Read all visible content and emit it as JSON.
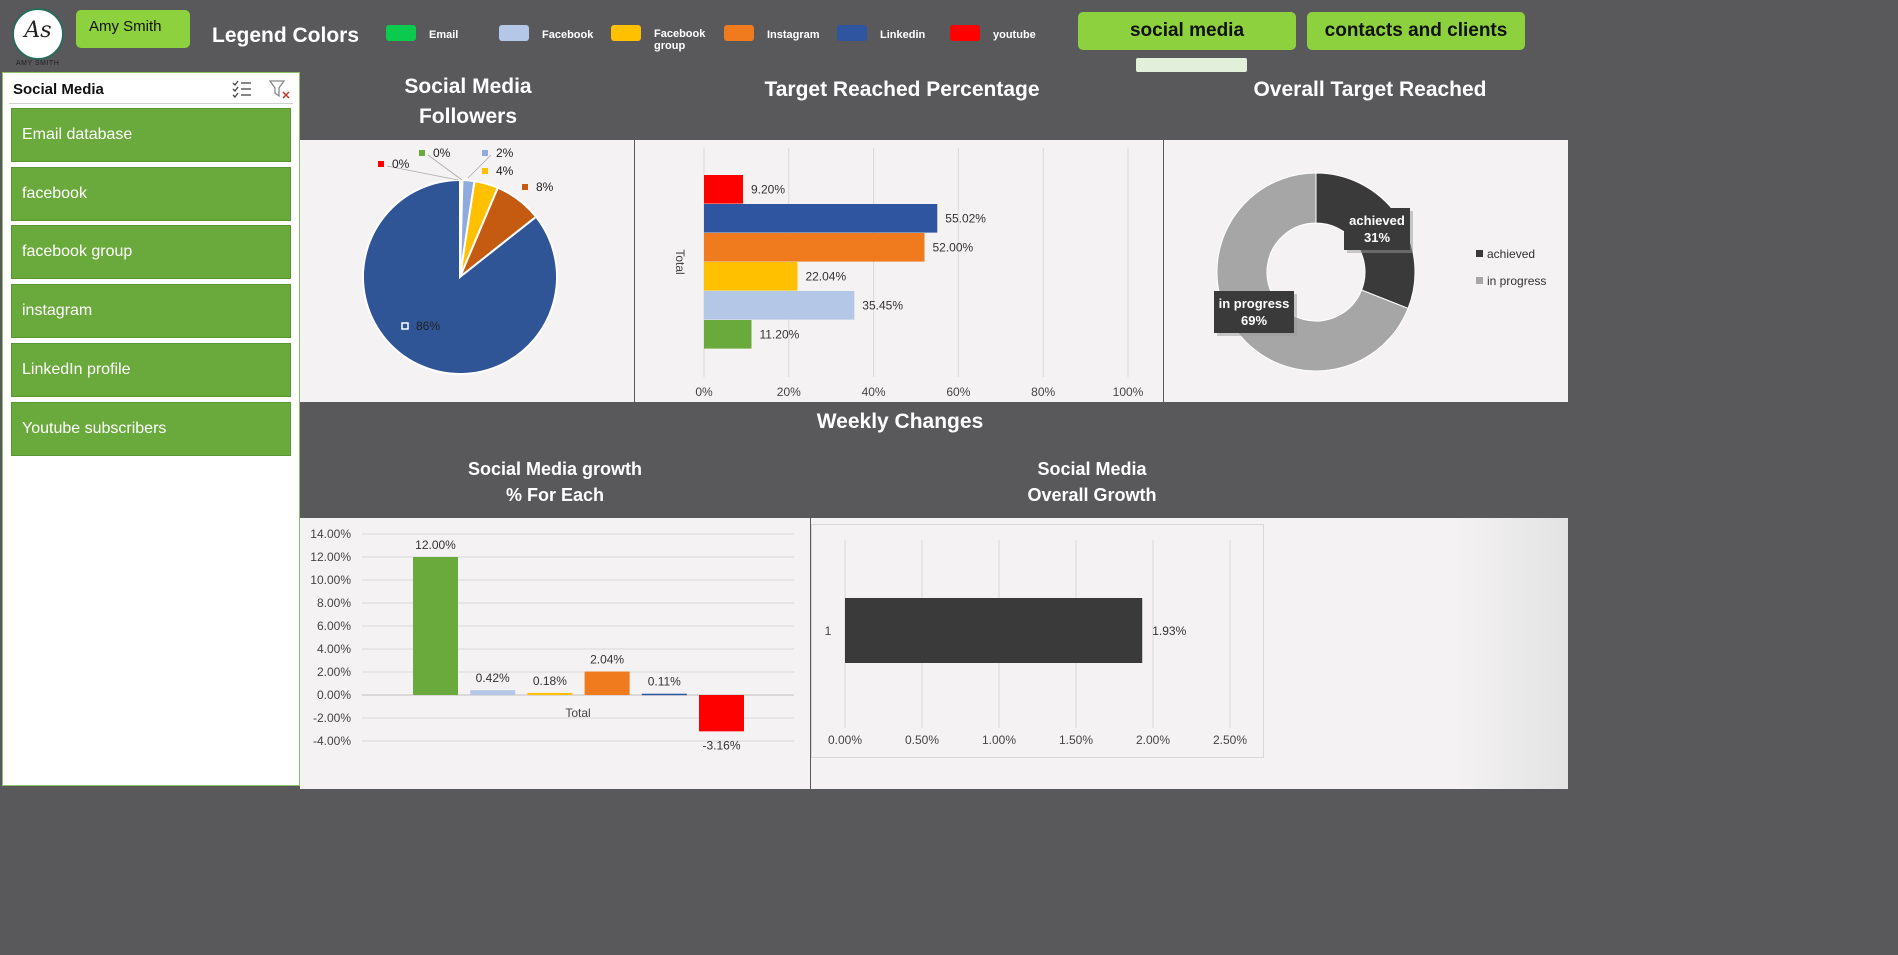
{
  "header": {
    "user_name": "Amy Smith",
    "logo_text": "As",
    "logo_caption": "AMY SMITH",
    "legend_title": "Legend Colors",
    "legend": [
      {
        "label": "Email",
        "color": "#0bca4e"
      },
      {
        "label": "Facebook",
        "color": "#b4c7e7"
      },
      {
        "label": "Facebook group",
        "color": "#ffc000"
      },
      {
        "label": "Instagram",
        "color": "#f07a1e"
      },
      {
        "label": "Linkedin",
        "color": "#2f55a0"
      },
      {
        "label": "youtube",
        "color": "#ff0000"
      }
    ],
    "nav_social": "social media",
    "nav_contacts": "contacts and clients"
  },
  "slicer": {
    "title": "Social Media",
    "multiselect_icon": "multi-select-icon",
    "clear_filter_icon": "clear-filter-icon",
    "items": [
      "Email database",
      "facebook",
      "facebook group",
      "instagram",
      "LinkedIn profile",
      "Youtube subscribers"
    ]
  },
  "sections": {
    "followers_title_1": "Social Media",
    "followers_title_2": "Followers",
    "target_title": "Target Reached Percentage",
    "overall_title": "Overall Target Reached",
    "weekly_title": "Weekly Changes",
    "growth_each_title_1": "Social Media growth",
    "growth_each_title_2": "% For Each",
    "overall_growth_title_1": "Social Media",
    "overall_growth_title_2": "Overall Growth"
  },
  "chart_data": [
    {
      "id": "followers-pie",
      "type": "pie",
      "categories": [
        "Email",
        "Facebook",
        "Facebook group",
        "Instagram",
        "Linkedin",
        "youtube"
      ],
      "values": [
        0,
        2,
        4,
        8,
        86,
        0
      ],
      "labels": [
        "0%",
        "2%",
        "4%",
        "8%",
        "86%",
        "0%"
      ],
      "colors": [
        "#6aaa3c",
        "#8faadc",
        "#ffc000",
        "#c55a11",
        "#2f5597",
        "#ff0000"
      ]
    },
    {
      "id": "target-bar",
      "type": "bar",
      "orientation": "horizontal",
      "category_label": "Total",
      "series": [
        {
          "value": 9.2,
          "label": "9.20%",
          "color": "#ff0000"
        },
        {
          "value": 55.02,
          "label": "55.02%",
          "color": "#2f55a0"
        },
        {
          "value": 52.0,
          "label": "52.00%",
          "color": "#f07a1e"
        },
        {
          "value": 22.04,
          "label": "22.04%",
          "color": "#ffc000"
        },
        {
          "value": 35.45,
          "label": "35.45%",
          "color": "#b4c7e7"
        },
        {
          "value": 11.2,
          "label": "11.20%",
          "color": "#6aaa3c"
        }
      ],
      "xlim": [
        0,
        100
      ],
      "xticks": [
        "0%",
        "20%",
        "40%",
        "60%",
        "80%",
        "100%"
      ]
    },
    {
      "id": "overall-donut",
      "type": "pie",
      "categories": [
        "achieved",
        "in progress"
      ],
      "values": [
        31,
        69
      ],
      "labels": [
        "31%",
        "69%"
      ],
      "colors": [
        "#3a3a3a",
        "#a6a6a6"
      ],
      "legend_placement": "right"
    },
    {
      "id": "growth-each-bar",
      "type": "bar",
      "category_label": "Total",
      "series": [
        {
          "value": 12.0,
          "label": "12.00%",
          "color": "#6aaa3c"
        },
        {
          "value": 0.42,
          "label": "0.42%",
          "color": "#b4c7e7"
        },
        {
          "value": 0.18,
          "label": "0.18%",
          "color": "#ffc000"
        },
        {
          "value": 2.04,
          "label": "2.04%",
          "color": "#f07a1e"
        },
        {
          "value": 0.11,
          "label": "0.11%",
          "color": "#2f55a0"
        },
        {
          "value": -3.16,
          "label": "-3.16%",
          "color": "#ff0000"
        }
      ],
      "ylim": [
        -4,
        14
      ],
      "yticks": [
        "14.00%",
        "12.00%",
        "10.00%",
        "8.00%",
        "6.00%",
        "4.00%",
        "2.00%",
        "0.00%",
        "-2.00%",
        "-4.00%"
      ]
    },
    {
      "id": "overall-growth-bar",
      "type": "bar",
      "orientation": "horizontal",
      "categories": [
        "1"
      ],
      "values": [
        1.93
      ],
      "labels": [
        "1.93%"
      ],
      "colors": [
        "#3a3a3a"
      ],
      "xlim": [
        0,
        2.5
      ],
      "xticks": [
        "0.00%",
        "0.50%",
        "1.00%",
        "1.50%",
        "2.00%",
        "2.50%"
      ]
    }
  ]
}
